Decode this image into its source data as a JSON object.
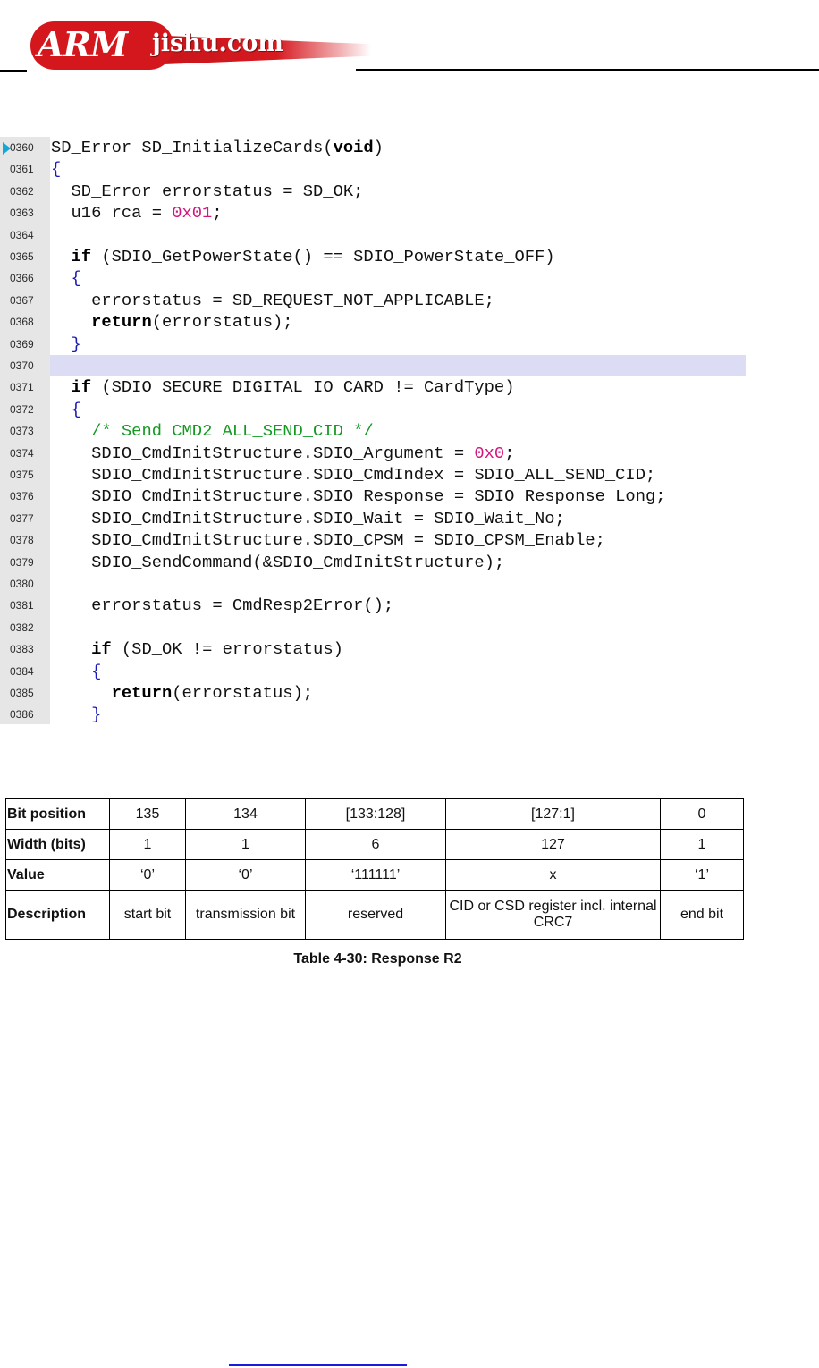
{
  "header": {
    "logo_arm": "ARM",
    "logo_site": "jishu.com"
  },
  "code": {
    "highlighted_line": "0370",
    "lines": [
      {
        "no": "0360",
        "html": "SD_Error SD_InitializeCards(<span class=\"kw\">void</span>)"
      },
      {
        "no": "0361",
        "html": "<span class=\"sym\">{</span>"
      },
      {
        "no": "0362",
        "html": "  SD_Error errorstatus = SD_OK;"
      },
      {
        "no": "0363",
        "html": "  u16 rca = <span class=\"num\">0x01</span>;"
      },
      {
        "no": "0364",
        "html": ""
      },
      {
        "no": "0365",
        "html": "  <span class=\"kw\">if</span> (SDIO_GetPowerState() == SDIO_PowerState_OFF)"
      },
      {
        "no": "0366",
        "html": "  <span class=\"sym\">{</span>"
      },
      {
        "no": "0367",
        "html": "    errorstatus = SD_REQUEST_NOT_APPLICABLE;"
      },
      {
        "no": "0368",
        "html": "    <span class=\"kw\">return</span>(errorstatus);"
      },
      {
        "no": "0369",
        "html": "  <span class=\"sym\">}</span>"
      },
      {
        "no": "0370",
        "html": ""
      },
      {
        "no": "0371",
        "html": "  <span class=\"kw\">if</span> (SDIO_SECURE_DIGITAL_IO_CARD != CardType)"
      },
      {
        "no": "0372",
        "html": "  <span class=\"sym\">{</span>"
      },
      {
        "no": "0373",
        "html": "    <span class=\"cmt\">/* Send CMD2 ALL_SEND_CID */</span>"
      },
      {
        "no": "0374",
        "html": "    SDIO_CmdInitStructure.SDIO_Argument = <span class=\"num\">0x0</span>;"
      },
      {
        "no": "0375",
        "html": "    SDIO_CmdInitStructure.SDIO_CmdIndex = SDIO_ALL_SEND_CID;"
      },
      {
        "no": "0376",
        "html": "    SDIO_CmdInitStructure.SDIO_Response = SDIO_Response_Long;"
      },
      {
        "no": "0377",
        "html": "    SDIO_CmdInitStructure.SDIO_Wait = SDIO_Wait_No;"
      },
      {
        "no": "0378",
        "html": "    SDIO_CmdInitStructure.SDIO_CPSM = SDIO_CPSM_Enable;"
      },
      {
        "no": "0379",
        "html": "    SDIO_SendCommand(&amp;SDIO_CmdInitStructure);"
      },
      {
        "no": "0380",
        "html": ""
      },
      {
        "no": "0381",
        "html": "    errorstatus = CmdResp2Error();"
      },
      {
        "no": "0382",
        "html": ""
      },
      {
        "no": "0383",
        "html": "    <span class=\"kw\">if</span> (SD_OK != errorstatus)"
      },
      {
        "no": "0384",
        "html": "    <span class=\"sym\">{</span>"
      },
      {
        "no": "0385",
        "html": "      <span class=\"kw\">return</span>(errorstatus);"
      },
      {
        "no": "0386",
        "html": "    <span class=\"sym\">}</span>"
      }
    ]
  },
  "table": {
    "rows": [
      {
        "header": "Bit position",
        "cells": [
          "135",
          "134",
          "[133:128]",
          "[127:1]",
          "0"
        ]
      },
      {
        "header": "Width (bits)",
        "cells": [
          "1",
          "1",
          "6",
          "127",
          "1"
        ]
      },
      {
        "header": "Value",
        "cells": [
          "‘0’",
          "‘0’",
          "‘111111’",
          "x",
          "‘1’"
        ]
      },
      {
        "header": "Description",
        "cells": [
          "start bit",
          "transmission bit",
          "reserved",
          "CID or CSD register incl. internal CRC7",
          "end bit"
        ]
      }
    ],
    "caption": "Table 4-30: Response R2"
  }
}
